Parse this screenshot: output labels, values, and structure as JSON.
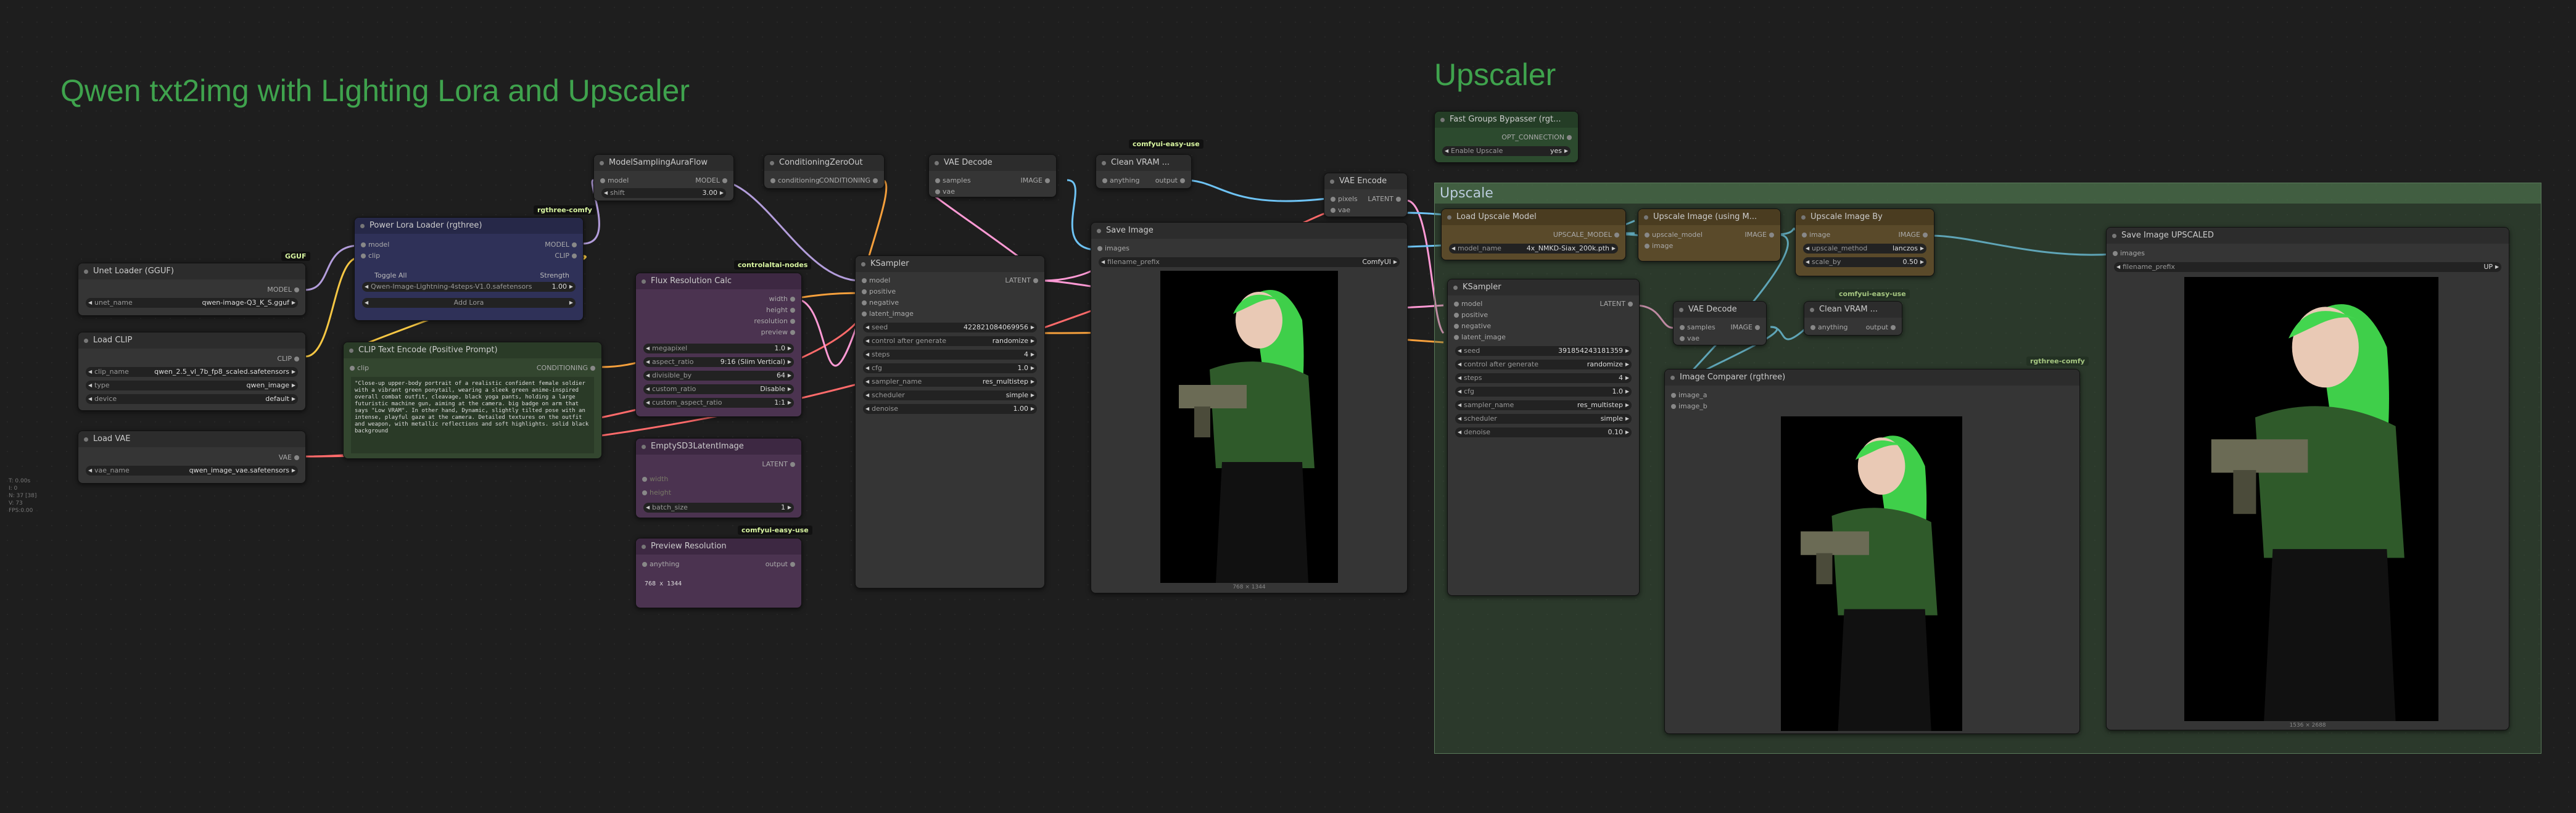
{
  "titles": {
    "main": "Qwen txt2img with Lighting Lora and Upscaler",
    "upscaler": "Upscaler",
    "group": "Upscale"
  },
  "tags": {
    "gguf": "GGUF",
    "rgthree1": "rgthree-comfy",
    "controlaltai": "controlaltai-nodes",
    "easyuse1": "comfyui-easy-use",
    "easyuse2": "comfyui-easy-use",
    "easyuse3": "comfyui-easy-use",
    "rgthree2": "rgthree-comfy"
  },
  "unet": {
    "title": "Unet Loader (GGUF)",
    "out": "MODEL",
    "k": "unet_name",
    "v": "qwen-image-Q3_K_S.gguf"
  },
  "clip": {
    "title": "Load CLIP",
    "out": "CLIP",
    "w1k": "clip_name",
    "w1v": "qwen_2.5_vl_7b_fp8_scaled.safetensors",
    "w2k": "type",
    "w2v": "qwen_image",
    "w3k": "device",
    "w3v": "default"
  },
  "vae": {
    "title": "Load VAE",
    "out": "VAE",
    "k": "vae_name",
    "v": "qwen_image_vae.safetensors"
  },
  "lora": {
    "title": "Power Lora Loader (rgthree)",
    "in1": "model",
    "in2": "clip",
    "out1": "MODEL",
    "out2": "CLIP",
    "toggle": "Toggle All",
    "strength": "Strength",
    "loraname": "Qwen-Image-Lightning-4steps-V1.0.safetensors",
    "loraval": "1.00",
    "add": "Add Lora"
  },
  "cliptext": {
    "title": "CLIP Text Encode (Positive Prompt)",
    "in": "clip",
    "out": "CONDITIONING",
    "text": "\"Close-up upper-body portrait of a realistic confident female soldier with a vibrant green ponytail, wearing a sleek green anime-inspired overall combat outfit, cleavage, black yoga pants, holding a large futuristic machine gun, aiming at the camera. big badge on arm that says \"Low VRAM\". In other hand, Dynamic, slightly tilted pose with an intense, playful gaze at the camera. Detailed textures on the outfit and weapon, with metallic reflections and soft highlights. solid black background"
  },
  "msaf": {
    "title": "ModelSamplingAuraFlow",
    "in": "model",
    "out": "MODEL",
    "k": "shift",
    "v": "3.00"
  },
  "czo": {
    "title": "ConditioningZeroOut",
    "in": "conditioning",
    "out": "CONDITIONING"
  },
  "vaedec1": {
    "title": "VAE Decode",
    "in1": "samples",
    "in2": "vae",
    "out": "IMAGE"
  },
  "clean1": {
    "title": "Clean VRAM ...",
    "in": "anything",
    "out": "output"
  },
  "flux": {
    "title": "Flux Resolution Calc",
    "o1": "width",
    "o2": "height",
    "o3": "resolution",
    "o4": "preview",
    "w": [
      [
        "megapixel",
        "1.0"
      ],
      [
        "aspect_ratio",
        "9:16 (Slim Vertical)"
      ],
      [
        "divisible_by",
        "64"
      ],
      [
        "custom_ratio",
        "Disable"
      ],
      [
        "custom_aspect_ratio",
        "1:1"
      ]
    ]
  },
  "empty": {
    "title": "EmptySD3LatentImage",
    "out": "LATENT",
    "i1": "width",
    "i2": "height",
    "k": "batch_size",
    "v": "1"
  },
  "preview": {
    "title": "Preview Resolution",
    "in": "anything",
    "out": "output",
    "text": "768 x 1344"
  },
  "ks1": {
    "title": "KSampler",
    "i1": "model",
    "i2": "positive",
    "i3": "negative",
    "i4": "latent_image",
    "out": "LATENT",
    "w": [
      [
        "seed",
        "422821084069956"
      ],
      [
        "control after generate",
        "randomize"
      ],
      [
        "steps",
        "4"
      ],
      [
        "cfg",
        "1.0"
      ],
      [
        "sampler_name",
        "res_multistep"
      ],
      [
        "scheduler",
        "simple"
      ],
      [
        "denoise",
        "1.00"
      ]
    ]
  },
  "save1": {
    "title": "Save Image",
    "in": "images",
    "k": "filename_prefix",
    "v": "ComfyUI",
    "dim": "768 × 1344"
  },
  "vaeenc": {
    "title": "VAE Encode",
    "in1": "pixels",
    "in2": "vae",
    "out": "LATENT"
  },
  "fgb": {
    "title": "Fast Groups Bypasser (rgt...",
    "out": "OPT_CONNECTION",
    "k": "Enable Upscale",
    "v": "yes"
  },
  "lum": {
    "title": "Load Upscale Model",
    "out": "UPSCALE_MODEL",
    "k": "model_name",
    "v": "4x_NMKD-Siax_200k.pth"
  },
  "uiu": {
    "title": "Upscale Image (using M...",
    "i1": "upscale_model",
    "i2": "image",
    "out": "IMAGE"
  },
  "uib": {
    "title": "Upscale Image By",
    "in": "image",
    "out": "IMAGE",
    "w1k": "upscale_method",
    "w1v": "lanczos",
    "w2k": "scale_by",
    "w2v": "0.50"
  },
  "ks2": {
    "title": "KSampler",
    "i1": "model",
    "i2": "positive",
    "i3": "negative",
    "i4": "latent_image",
    "out": "LATENT",
    "w": [
      [
        "seed",
        "391854243181359"
      ],
      [
        "control after generate",
        "randomize"
      ],
      [
        "steps",
        "4"
      ],
      [
        "cfg",
        "1.0"
      ],
      [
        "sampler_name",
        "res_multistep"
      ],
      [
        "scheduler",
        "simple"
      ],
      [
        "denoise",
        "0.10"
      ]
    ]
  },
  "vaedec2": {
    "title": "VAE Decode",
    "in1": "samples",
    "in2": "vae",
    "out": "IMAGE"
  },
  "clean2": {
    "title": "Clean VRAM ...",
    "in": "anything",
    "out": "output"
  },
  "cmp": {
    "title": "Image Comparer (rgthree)",
    "i1": "image_a",
    "i2": "image_b"
  },
  "save2": {
    "title": "Save Image UPSCALED",
    "in": "images",
    "k": "filename_prefix",
    "v": "UP",
    "dim": "1536 × 2688"
  },
  "status": {
    "l1": "T: 0.00s",
    "l2": "I: 0",
    "l3": "N: 37 [38]",
    "l4": "V: 73",
    "l5": "FPS:0.00"
  }
}
